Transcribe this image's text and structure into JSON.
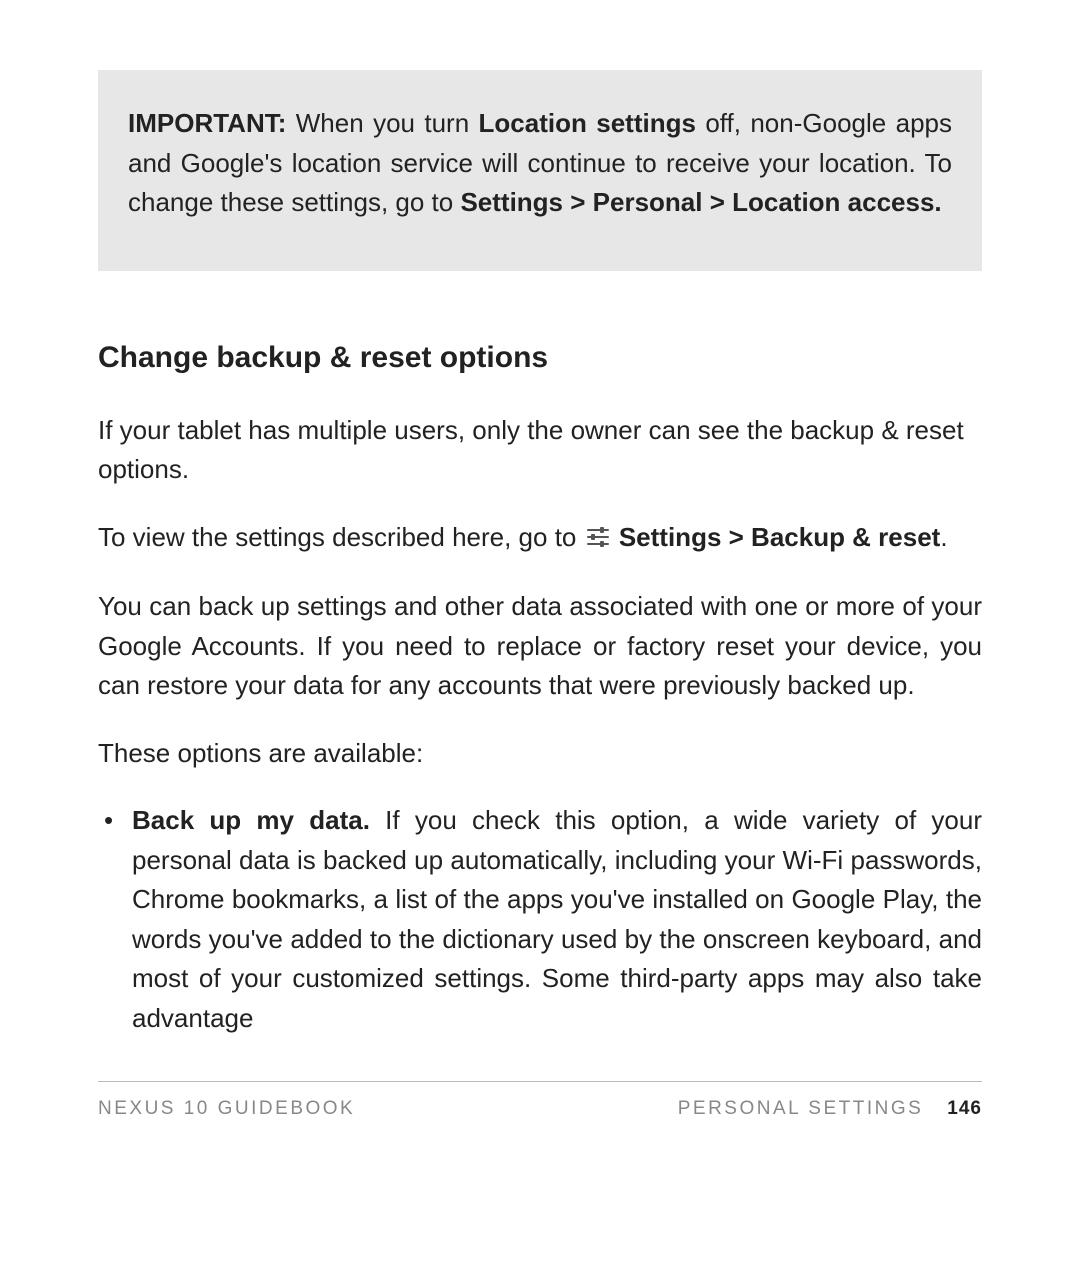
{
  "callout": {
    "label": "IMPORTANT:",
    "text_before_bold1": " When you turn ",
    "bold1": "Location settings",
    "text_mid": " off, non-Google apps and Google's location service will continue to receive your location. To change these settings, go to ",
    "bold2": "Settings > Personal > Location access."
  },
  "heading": "Change backup & reset options",
  "intro": "If your tablet has multiple users, only the owner can see the backup & reset options.",
  "settings_path": {
    "prefix": "To view the settings described here, go to ",
    "bold": "Settings > Backup & reset",
    "suffix": "."
  },
  "backup_desc": "You can back up settings and other data associated with one or more of your Google Accounts. If you need to replace or factory reset your device, you can restore your data for any accounts that were previously backed up.",
  "options_intro": "These options are available:",
  "option1": {
    "title": "Back up my data.",
    "body": " If you check this option, a wide variety of your personal data is backed up automatically, including your Wi-Fi passwords, Chrome bookmarks, a list of the apps you've installed on Google Play, the words you've added to the dictionary used by the onscreen keyboard, and most of your customized settings. Some third-party apps may also take advantage"
  },
  "footer": {
    "left": "NEXUS 10 GUIDEBOOK",
    "section": "PERSONAL SETTINGS",
    "page": "146"
  }
}
